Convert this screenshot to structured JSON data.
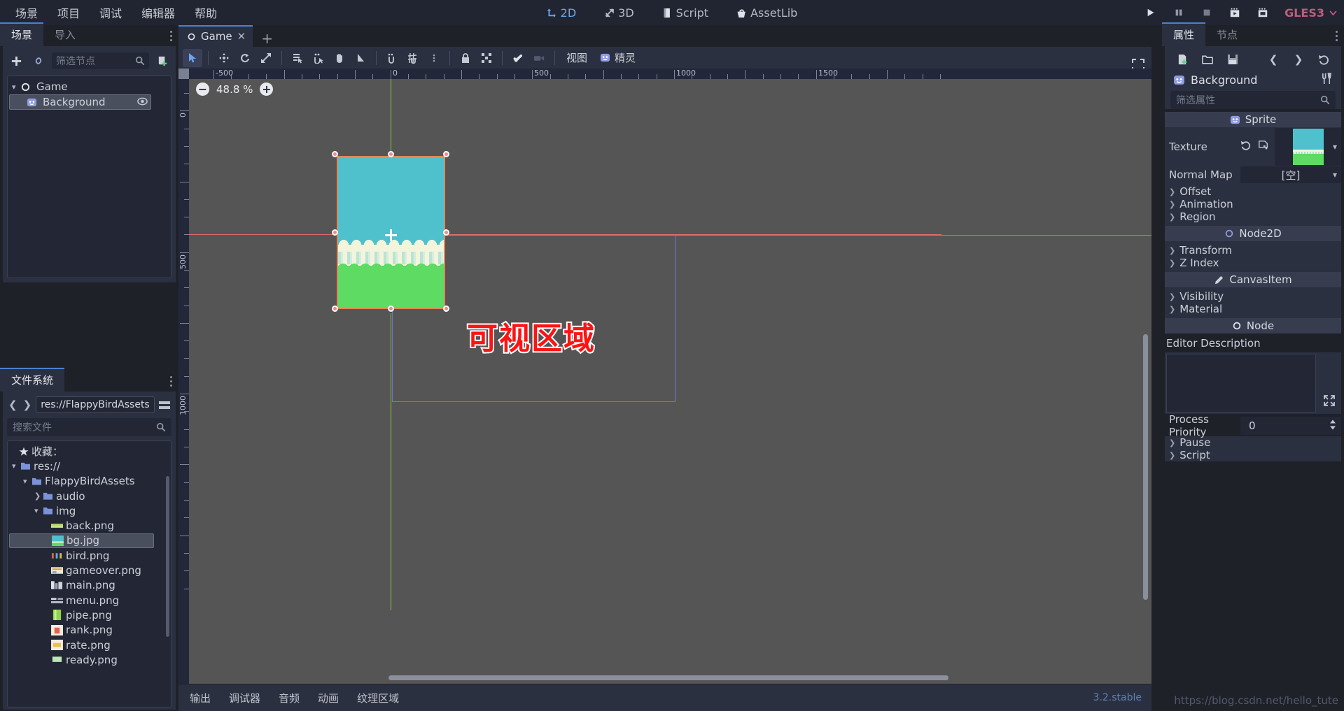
{
  "menubar": {
    "items": [
      {
        "label": "场景",
        "name": "menu-scene"
      },
      {
        "label": "项目",
        "name": "menu-project"
      },
      {
        "label": "调试",
        "name": "menu-debug"
      },
      {
        "label": "编辑器",
        "name": "menu-editor"
      },
      {
        "label": "帮助",
        "name": "menu-help"
      }
    ],
    "modes": [
      {
        "label": "2D",
        "icon": "2d-icon",
        "active": true
      },
      {
        "label": "3D",
        "icon": "3d-icon",
        "active": false
      },
      {
        "label": "Script",
        "icon": "script-icon",
        "active": false
      },
      {
        "label": "AssetLib",
        "icon": "assetlib-icon",
        "active": false
      }
    ],
    "play_controls": [
      "play-icon",
      "pause-icon",
      "stop-icon",
      "play-scene-icon",
      "play-custom-scene-icon"
    ],
    "renderer": "GLES3",
    "accent_color": "#6da5ef",
    "renderer_color": "#bd5e7d"
  },
  "scene_dock": {
    "tabs": [
      {
        "label": "场景",
        "active": true
      },
      {
        "label": "导入",
        "active": false
      }
    ],
    "toolbar": {
      "add_icon": "plus-icon",
      "link_icon": "instance-child-scene-icon",
      "filter_placeholder": "筛选节点",
      "search_icon": "search-icon",
      "create_script_icon": "attach-script-icon"
    },
    "tree": [
      {
        "label": "Game",
        "icon": "node2d-icon",
        "depth": 0,
        "selected": false,
        "expanded": true
      },
      {
        "label": "Background",
        "icon": "sprite-icon",
        "depth": 1,
        "selected": true,
        "visibility_icon": "eye-icon"
      }
    ]
  },
  "filesystem_dock": {
    "tab": "文件系统",
    "back_icon": "chevron-left-icon",
    "forward_icon": "chevron-right-icon",
    "path": "res://FlappyBirdAssets",
    "split_mode_icon": "split-view-icon",
    "search_placeholder": "搜索文件",
    "search_icon": "search-icon",
    "tree": [
      {
        "label": "收藏：",
        "icon": "star-icon",
        "depth": 0,
        "type": "favorites"
      },
      {
        "label": "res://",
        "icon": "folder-icon",
        "depth": 0,
        "type": "folder",
        "expanded": true
      },
      {
        "label": "FlappyBirdAssets",
        "icon": "folder-icon",
        "depth": 1,
        "type": "folder",
        "expanded": true
      },
      {
        "label": "audio",
        "icon": "folder-icon",
        "depth": 2,
        "type": "folder",
        "expanded": false
      },
      {
        "label": "img",
        "icon": "folder-icon",
        "depth": 2,
        "type": "folder",
        "expanded": true
      },
      {
        "label": "back.png",
        "icon": "image-file-icon",
        "depth": 3,
        "type": "file",
        "selected": false
      },
      {
        "label": "bg.jpg",
        "icon": "image-file-icon",
        "depth": 3,
        "type": "file",
        "selected": true
      },
      {
        "label": "bird.png",
        "icon": "image-file-icon",
        "depth": 3,
        "type": "file",
        "selected": false
      },
      {
        "label": "gameover.png",
        "icon": "image-file-icon",
        "depth": 3,
        "type": "file",
        "selected": false
      },
      {
        "label": "main.png",
        "icon": "image-file-icon",
        "depth": 3,
        "type": "file",
        "selected": false
      },
      {
        "label": "menu.png",
        "icon": "image-file-icon",
        "depth": 3,
        "type": "file",
        "selected": false
      },
      {
        "label": "pipe.png",
        "icon": "image-file-icon",
        "depth": 3,
        "type": "file",
        "selected": false
      },
      {
        "label": "rank.png",
        "icon": "image-file-icon",
        "depth": 3,
        "type": "file",
        "selected": false
      },
      {
        "label": "rate.png",
        "icon": "image-file-icon",
        "depth": 3,
        "type": "file",
        "selected": false
      },
      {
        "label": "ready.png",
        "icon": "image-file-icon",
        "depth": 3,
        "type": "file",
        "selected": false
      }
    ]
  },
  "viewport": {
    "scene_tab": "Game",
    "scene_tab_icon": "node2d-icon",
    "close_icon": "close-icon",
    "add_tab_icon": "plus-icon",
    "fullscreen_icon": "fullscreen-icon",
    "toolbar_tools": [
      {
        "name": "select-tool",
        "icon": "cursor-icon",
        "active": true
      },
      {
        "name": "move-tool",
        "icon": "move-icon",
        "active": false
      },
      {
        "name": "rotate-tool",
        "icon": "rotate-icon",
        "active": false
      },
      {
        "name": "scale-tool",
        "icon": "scale-icon",
        "active": false
      },
      {
        "name": "list-select-tool",
        "icon": "list-select-icon",
        "active": false
      },
      {
        "name": "ruler-select-tool",
        "icon": "pin-select-icon",
        "active": false
      },
      {
        "name": "pan-tool",
        "icon": "hand-icon",
        "active": false
      },
      {
        "name": "ruler-tool",
        "icon": "ruler-icon",
        "active": false
      },
      {
        "name": "snap-mode",
        "icon": "snap-icon",
        "active": false
      },
      {
        "name": "grid-snap",
        "icon": "grid-snap-icon",
        "active": false
      },
      {
        "name": "snap-options",
        "icon": "kebab-icon",
        "active": false
      },
      {
        "name": "lock-node",
        "icon": "lock-icon",
        "active": false
      },
      {
        "name": "group-node",
        "icon": "group-icon",
        "active": false
      },
      {
        "name": "skeleton-bone",
        "icon": "bone-icon",
        "active": false
      },
      {
        "name": "camera-override",
        "icon": "camera-icon",
        "active": false
      }
    ],
    "toolbar_menus": [
      {
        "label": "视图",
        "name": "view-menu"
      },
      {
        "label": "精灵",
        "name": "sprite-menu",
        "icon": "sprite-icon"
      }
    ],
    "zoom": {
      "value": "48.8 %",
      "minus_icon": "minus-circle-icon",
      "plus_icon": "plus-circle-icon"
    },
    "ruler_h_labels": [
      "-500",
      "0",
      "500",
      "1000",
      "1500"
    ],
    "ruler_v_labels": [
      "0",
      "500",
      "1000"
    ],
    "overlay_annotation": "可视区域",
    "overlay_color": "#fb1414",
    "selection_border_color": "#e08a5a",
    "handle_color": "#f08a8a",
    "sprite_sky_color": "#4fc1cd",
    "sprite_grass_color": "#5ddb63",
    "sprite_cloud_color": "#f2f5dc",
    "view_rect_color": "#6d74d8"
  },
  "bottom_panel": {
    "items": [
      "输出",
      "调试器",
      "音频",
      "动画",
      "纹理区域"
    ],
    "version": "3.2.stable"
  },
  "inspector": {
    "tabs": [
      {
        "label": "属性",
        "active": true
      },
      {
        "label": "节点",
        "active": false
      }
    ],
    "toolbar_icons": [
      "new-resource-icon",
      "open-resource-icon",
      "save-resource-icon",
      "history-prev-icon",
      "history-next-icon",
      "history-icon"
    ],
    "node_name": "Background",
    "node_icon": "sprite-icon",
    "object_menu_icon": "tools-icon",
    "filter_placeholder": "筛选属性",
    "search_icon": "search-icon",
    "sections": [
      {
        "category": "Sprite",
        "icon": "sprite-icon",
        "properties": [
          {
            "label": "Texture",
            "type": "texture",
            "value": "",
            "reset_icon": "reload-icon",
            "edit_icon": "quick-load-icon",
            "dropdown_icon": "chevron-down-icon"
          },
          {
            "label": "Normal Map",
            "type": "resource",
            "value": "[空]",
            "dropdown_icon": "chevron-down-icon"
          },
          {
            "label": "Offset",
            "type": "group"
          },
          {
            "label": "Animation",
            "type": "group"
          },
          {
            "label": "Region",
            "type": "group"
          }
        ]
      },
      {
        "category": "Node2D",
        "icon": "node2d-icon",
        "properties": [
          {
            "label": "Transform",
            "type": "group"
          },
          {
            "label": "Z Index",
            "type": "group"
          }
        ]
      },
      {
        "category": "CanvasItem",
        "icon": "canvasitem-icon",
        "properties": [
          {
            "label": "Visibility",
            "type": "group"
          },
          {
            "label": "Material",
            "type": "group"
          }
        ]
      },
      {
        "category": "Node",
        "icon": "node-icon",
        "properties": [
          {
            "label": "Editor Description",
            "type": "multiline",
            "value": "",
            "expand_icon": "expand-icon"
          },
          {
            "label": "Process Priority",
            "type": "number",
            "value": "0",
            "spinner_icon": "updown-icon"
          },
          {
            "label": "Pause",
            "type": "group"
          },
          {
            "label": "Script",
            "type": "group"
          }
        ]
      }
    ]
  },
  "watermark": "https://blog.csdn.net/hello_tute"
}
